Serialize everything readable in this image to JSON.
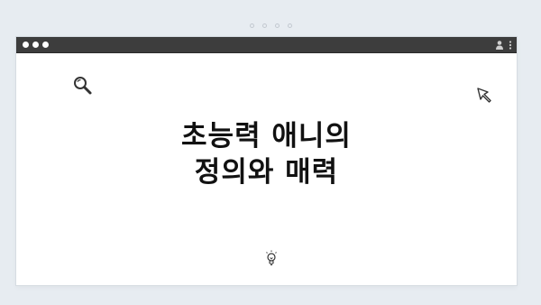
{
  "page": {
    "background": "#e7ecf1",
    "pager_count": 4
  },
  "window": {
    "titlebar_color": "#3d3d3d",
    "icons": [
      "user-icon",
      "kebab-menu-icon"
    ]
  },
  "slide": {
    "title_line_1": "초능력 애니의",
    "title_line_2": "정의와 매력",
    "decorations": [
      "search-icon",
      "cursor-arrow-icon",
      "lightbulb-icon"
    ]
  }
}
